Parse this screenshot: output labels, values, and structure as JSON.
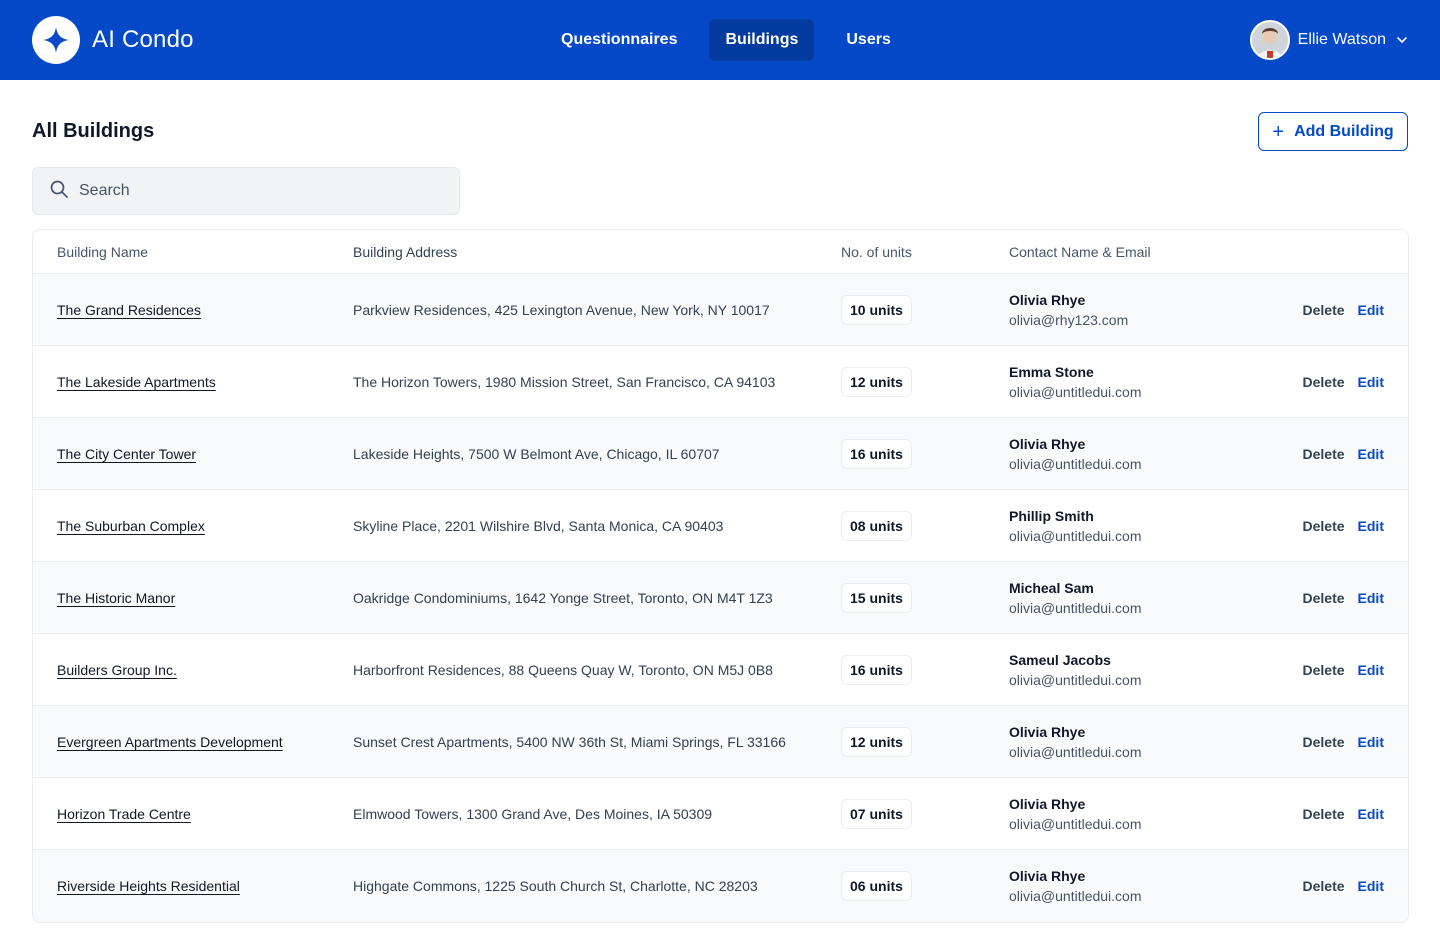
{
  "app": {
    "name": "AI Condo",
    "logo_icon": "sparkle-icon"
  },
  "nav": {
    "items": [
      {
        "label": "Questionnaires",
        "active": false
      },
      {
        "label": "Buildings",
        "active": true
      },
      {
        "label": "Users",
        "active": false
      }
    ]
  },
  "user": {
    "name": "Ellie Watson",
    "avatar_icon": "user-avatar"
  },
  "page": {
    "title": "All Buildings",
    "add_button": "Add Building"
  },
  "search": {
    "placeholder": "Search",
    "value": ""
  },
  "table": {
    "headers": {
      "name": "Building Name",
      "address": "Building Address",
      "units": "No. of units",
      "contact": "Contact Name & Email"
    },
    "actions": {
      "delete": "Delete",
      "edit": "Edit"
    },
    "rows": [
      {
        "name": "The Grand Residences",
        "address": "Parkview Residences, 425 Lexington Avenue, New York, NY 10017",
        "units": "10 units",
        "contact_name": "Olivia Rhye",
        "contact_email": "olivia@rhy123.com"
      },
      {
        "name": "The Lakeside Apartments",
        "address": "The Horizon Towers, 1980 Mission Street, San Francisco, CA 94103",
        "units": "12 units",
        "contact_name": "Emma Stone",
        "contact_email": "olivia@untitledui.com"
      },
      {
        "name": "The City Center Tower",
        "address": "Lakeside Heights, 7500 W Belmont Ave, Chicago, IL 60707",
        "units": "16 units",
        "contact_name": "Olivia Rhye",
        "contact_email": "olivia@untitledui.com"
      },
      {
        "name": "The Suburban Complex",
        "address": "Skyline Place, 2201 Wilshire Blvd, Santa Monica, CA 90403",
        "units": "08 units",
        "contact_name": "Phillip Smith",
        "contact_email": "olivia@untitledui.com"
      },
      {
        "name": "The Historic Manor",
        "address": "Oakridge Condominiums, 1642 Yonge Street, Toronto, ON M4T 1Z3",
        "units": "15 units",
        "contact_name": "Micheal Sam",
        "contact_email": "olivia@untitledui.com"
      },
      {
        "name": "Builders Group Inc.",
        "address": "Harborfront Residences, 88 Queens Quay W, Toronto, ON M5J 0B8",
        "units": "16 units",
        "contact_name": "Sameul Jacobs",
        "contact_email": "olivia@untitledui.com"
      },
      {
        "name": "Evergreen Apartments Development",
        "address": "Sunset Crest Apartments, 5400 NW 36th St, Miami Springs, FL 33166",
        "units": "12 units",
        "contact_name": "Olivia Rhye",
        "contact_email": "olivia@untitledui.com"
      },
      {
        "name": "Horizon Trade Centre",
        "address": "Elmwood Towers, 1300 Grand Ave, Des Moines, IA 50309",
        "units": "07 units",
        "contact_name": "Olivia Rhye",
        "contact_email": "olivia@untitledui.com"
      },
      {
        "name": "Riverside Heights Residential",
        "address": "Highgate Commons, 1225 South Church St, Charlotte, NC 28203",
        "units": "06 units",
        "contact_name": "Olivia Rhye",
        "contact_email": "olivia@untitledui.com"
      }
    ]
  },
  "colors": {
    "brand": "#0549c8",
    "brand_active": "#033b9e"
  }
}
